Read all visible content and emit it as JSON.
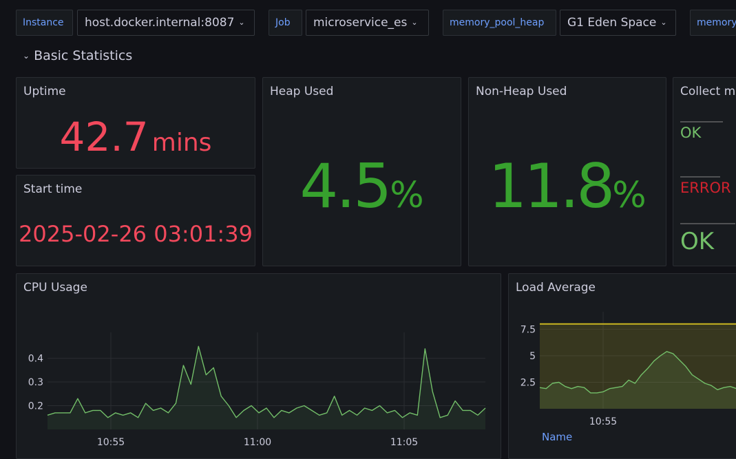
{
  "variables": [
    {
      "label": "Instance",
      "value": "host.docker.internal:8087"
    },
    {
      "label": "Job",
      "value": "microservice_es"
    },
    {
      "label": "memory_pool_heap",
      "value": "G1 Eden Space"
    },
    {
      "label": "memory",
      "value": ""
    }
  ],
  "row": {
    "title": "Basic Statistics"
  },
  "panels": {
    "uptime": {
      "title": "Uptime",
      "value": "42.7",
      "unit": "mins"
    },
    "start_time": {
      "title": "Start time",
      "value": "2025-02-26 03:01:39"
    },
    "heap_used": {
      "title": "Heap Used",
      "value": "4.5",
      "unit": "%"
    },
    "non_heap_used": {
      "title": "Non-Heap Used",
      "value": "11.8",
      "unit": "%"
    },
    "collect": {
      "title": "Collect m",
      "items": [
        "OK",
        "ERROR",
        "OK"
      ]
    },
    "cpu": {
      "title": "CPU Usage"
    },
    "load": {
      "title": "Load Average",
      "legend_header": "Name"
    }
  },
  "colors": {
    "red": "#f2495c",
    "green": "#37a12e",
    "light_green": "#73bf69",
    "error_red": "#d0222e",
    "yellow": "#c9b520",
    "link_blue": "#6e9fff"
  },
  "chart_data": [
    {
      "type": "area",
      "title": "CPU Usage",
      "x_ticks": [
        "10:55",
        "11:00",
        "11:05"
      ],
      "y_ticks": [
        0.2,
        0.3,
        0.4
      ],
      "ylim": [
        0.1,
        0.48
      ],
      "x": [
        0,
        1,
        2,
        3,
        4,
        5,
        6,
        7,
        8,
        9,
        10,
        11,
        12,
        13,
        14,
        15,
        16,
        17,
        18,
        19,
        20,
        21,
        22,
        23,
        24,
        25,
        26,
        27,
        28,
        29,
        30,
        31,
        32,
        33,
        34,
        35,
        36,
        37,
        38,
        39,
        40,
        41,
        42,
        43,
        44,
        45,
        46,
        47,
        48,
        49,
        50,
        51,
        52,
        53,
        54,
        55,
        56,
        57,
        58
      ],
      "series": [
        {
          "values": [
            0.16,
            0.17,
            0.17,
            0.17,
            0.23,
            0.17,
            0.18,
            0.18,
            0.15,
            0.17,
            0.16,
            0.17,
            0.15,
            0.21,
            0.18,
            0.19,
            0.17,
            0.21,
            0.37,
            0.29,
            0.45,
            0.33,
            0.36,
            0.24,
            0.2,
            0.15,
            0.18,
            0.2,
            0.17,
            0.19,
            0.15,
            0.18,
            0.17,
            0.19,
            0.2,
            0.18,
            0.16,
            0.17,
            0.24,
            0.16,
            0.18,
            0.16,
            0.19,
            0.18,
            0.2,
            0.17,
            0.18,
            0.15,
            0.17,
            0.16,
            0.44,
            0.26,
            0.15,
            0.16,
            0.22,
            0.18,
            0.18,
            0.16,
            0.19
          ]
        }
      ]
    },
    {
      "type": "area",
      "title": "Load Average",
      "x_ticks": [
        "10:55"
      ],
      "y_ticks": [
        2.5,
        5,
        7.5
      ],
      "ylim": [
        0,
        8.5
      ],
      "threshold": 8,
      "x": [
        0,
        1,
        2,
        3,
        4,
        5,
        6,
        7,
        8,
        9,
        10,
        11,
        12,
        13,
        14,
        15,
        16,
        17,
        18,
        19,
        20,
        21,
        22,
        23,
        24,
        25,
        26,
        27,
        28,
        29,
        30,
        31,
        32
      ],
      "series": [
        {
          "values": [
            2,
            1.9,
            2.4,
            2.5,
            2.1,
            1.9,
            2.1,
            2,
            1.5,
            1.5,
            1.6,
            1.9,
            2,
            2.1,
            2.7,
            2.4,
            3.2,
            3.8,
            4.5,
            5,
            5.4,
            5.2,
            4.6,
            4,
            3.2,
            2.8,
            2.4,
            2.2,
            1.8,
            2,
            2.1,
            1.9,
            1.8
          ]
        }
      ]
    }
  ]
}
